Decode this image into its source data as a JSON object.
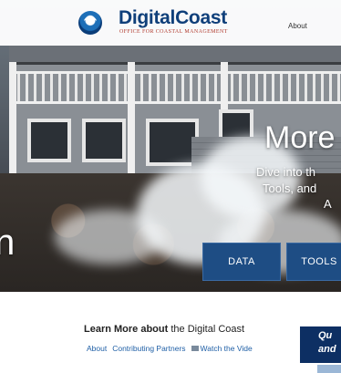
{
  "header": {
    "brand": "DigitalCoast",
    "tagline": "OFFICE FOR COASTAL MANAGEMENT",
    "nav_about": "About"
  },
  "hero": {
    "title_partial": "More",
    "line1": "Dive into th",
    "line2": "Tools, and",
    "line3": "A",
    "left_partial": "n"
  },
  "buttons": {
    "data": "DATA",
    "tools": "TOOLS"
  },
  "learn": {
    "bold": "Learn More about",
    "rest": " the Digital Coast",
    "links": {
      "about": "About",
      "partners": "Contributing Partners",
      "video": "Watch the Vide"
    }
  },
  "callout": {
    "line1": "Qu",
    "line2": "and"
  },
  "colors": {
    "brand": "#0f3f7a",
    "button": "#1e4d84",
    "callout": "#0d2f63",
    "link": "#1f5fa6"
  }
}
